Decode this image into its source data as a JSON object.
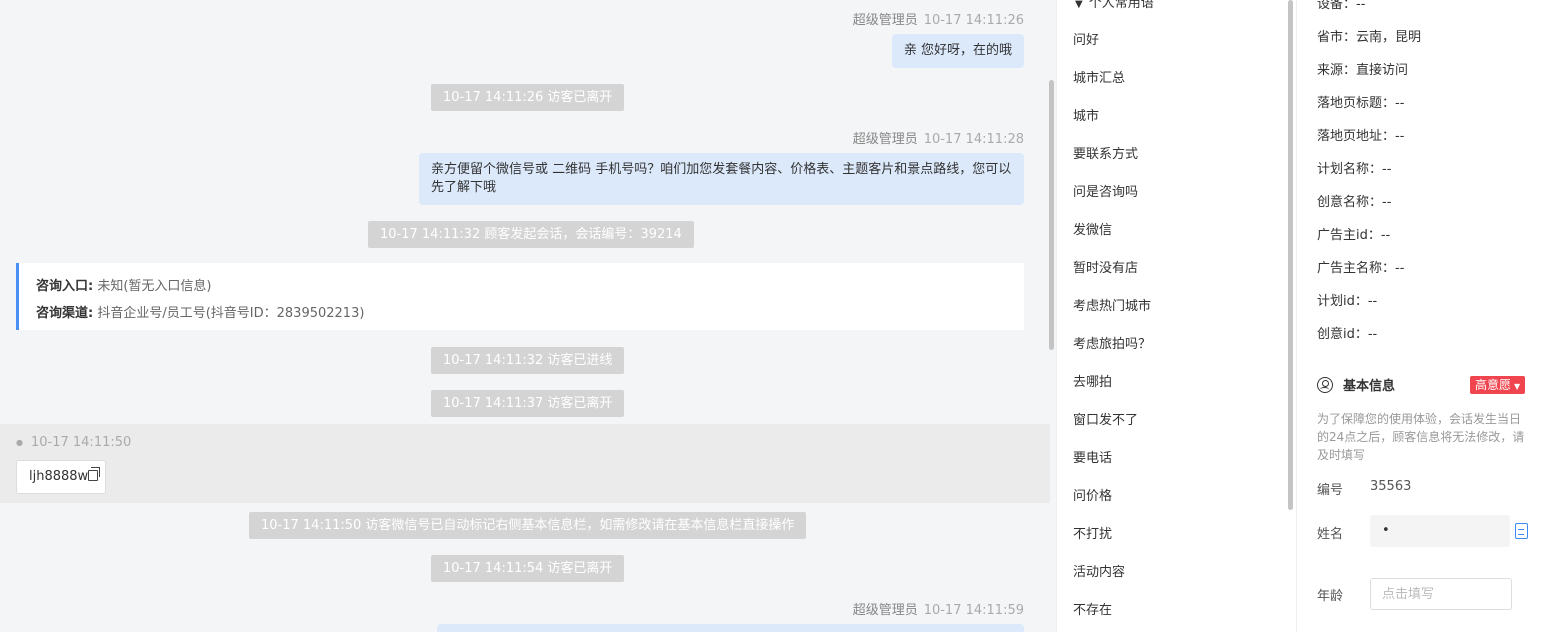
{
  "chat": {
    "messages": [
      {
        "sender": "超级管理员",
        "time": "10-17 14:11:26",
        "text": "亲 您好呀，在的哦"
      },
      {
        "sender": "超级管理员",
        "time": "10-17 14:11:28",
        "text": "亲方便留个微信号或 二维码 手机号吗？咱们加您发套餐内容、价格表、主题客片和景点路线，您可以先了解下哦"
      },
      {
        "sender": "超级管理员",
        "time": "10-17 14:11:59",
        "text": ""
      }
    ],
    "system": [
      "10-17 14:11:26 访客已离开",
      "10-17 14:11:32 顾客发起会话，会话编号：39214",
      "10-17 14:11:32 访客已进线",
      "10-17 14:11:37 访客已离开",
      "10-17 14:11:50 访客微信号已自动标记右侧基本信息栏，如需修改请在基本信息栏直接操作",
      "10-17 14:11:54 访客已离开"
    ],
    "info_card": {
      "entry_label": "咨询入口:",
      "entry_value": "未知(暂无入口信息)",
      "channel_label": "咨询渠道:",
      "channel_value": "抖音企业号/员工号(抖音号ID：2839502213)"
    },
    "visitor_msg": {
      "time": "10-17 14:11:50",
      "text": "ljh8888w"
    }
  },
  "phrases": {
    "group_title": "个人常用语",
    "items": [
      "问好",
      "城市汇总",
      "城市",
      "要联系方式",
      "问是咨询吗",
      "发微信",
      "暂时没有店",
      "考虑热门城市",
      "考虑旅拍吗？",
      "去哪拍",
      "窗口发不了",
      "要电话",
      "问价格",
      "不打扰",
      "活动内容",
      "不存在"
    ]
  },
  "info": {
    "fields": [
      "设备：--",
      "省市：云南，昆明",
      "来源：直接访问",
      "落地页标题：--",
      "落地页地址：--",
      "计划名称：--",
      "创意名称：--",
      "广告主id：--",
      "广告主名称：--",
      "计划id：--",
      "创意id：--"
    ],
    "basic": {
      "title": "基本信息",
      "intent": "高意愿",
      "notice": "为了保障您的使用体验，会话发生当日的24点之后，顾客信息将无法修改，请及时填写",
      "number_label": "编号",
      "number_value": "35563",
      "name_label": "姓名",
      "name_value": "•",
      "age_label": "年龄",
      "age_placeholder": "点击填写"
    }
  },
  "colors": {
    "accent": "#3d8af7",
    "bubble": "#dbe9fb",
    "badge": "#f0444f"
  }
}
